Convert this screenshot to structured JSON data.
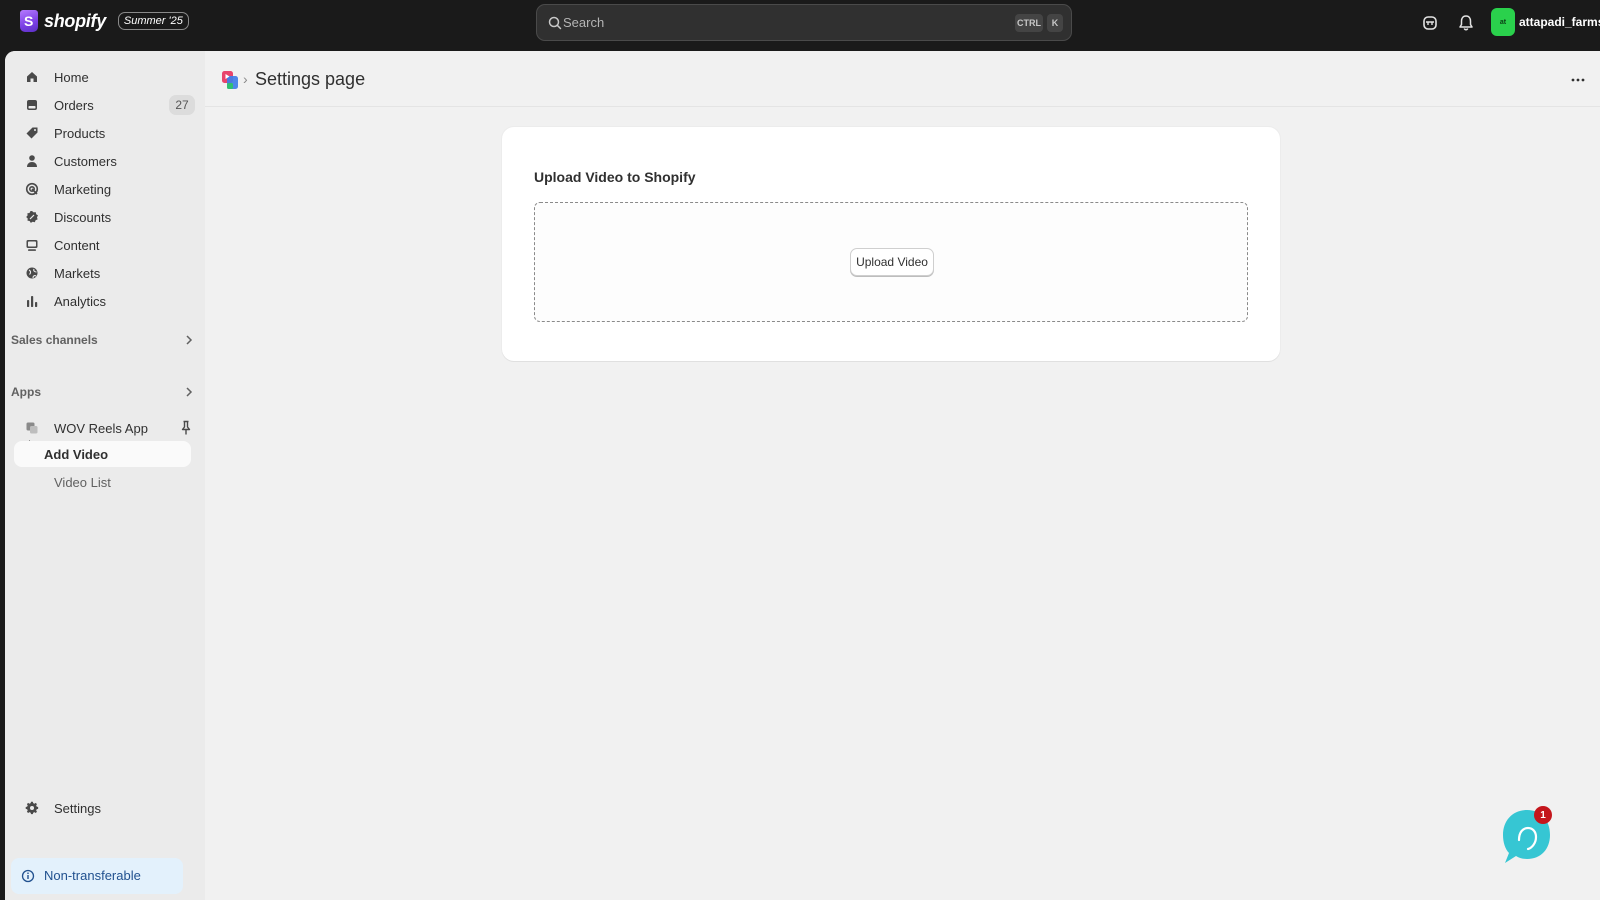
{
  "topbar": {
    "brand": "shopify",
    "edition": "Summer '25",
    "search_placeholder": "Search",
    "shortcut_ctrl": "CTRL",
    "shortcut_k": "K",
    "account_initials": "at",
    "account_name": "attapadi_farms"
  },
  "sidebar": {
    "items": [
      {
        "label": "Home",
        "icon": "home-icon"
      },
      {
        "label": "Orders",
        "icon": "orders-icon",
        "badge": "27"
      },
      {
        "label": "Products",
        "icon": "tag-icon"
      },
      {
        "label": "Customers",
        "icon": "person-icon"
      },
      {
        "label": "Marketing",
        "icon": "target-icon"
      },
      {
        "label": "Discounts",
        "icon": "discount-icon"
      },
      {
        "label": "Content",
        "icon": "content-icon"
      },
      {
        "label": "Markets",
        "icon": "globe-icon"
      },
      {
        "label": "Analytics",
        "icon": "bar-chart-icon"
      }
    ],
    "sales_channels_label": "Sales channels",
    "apps_label": "Apps",
    "app_name": "WOV Reels App",
    "app_subitems": [
      "Add Video",
      "Video List"
    ],
    "settings_label": "Settings",
    "nontransferable_label": "Non-transferable"
  },
  "main": {
    "page_title": "Settings page",
    "card_title": "Upload Video to Shopify",
    "upload_button": "Upload Video"
  },
  "chat": {
    "badge": "1"
  },
  "colors": {
    "topbar_bg": "#1a1a1a",
    "avatar": "#2ad14c",
    "chat_bubble": "#36c6d3",
    "badge_red": "#c4161c",
    "info_bg": "#e3f1fc"
  }
}
